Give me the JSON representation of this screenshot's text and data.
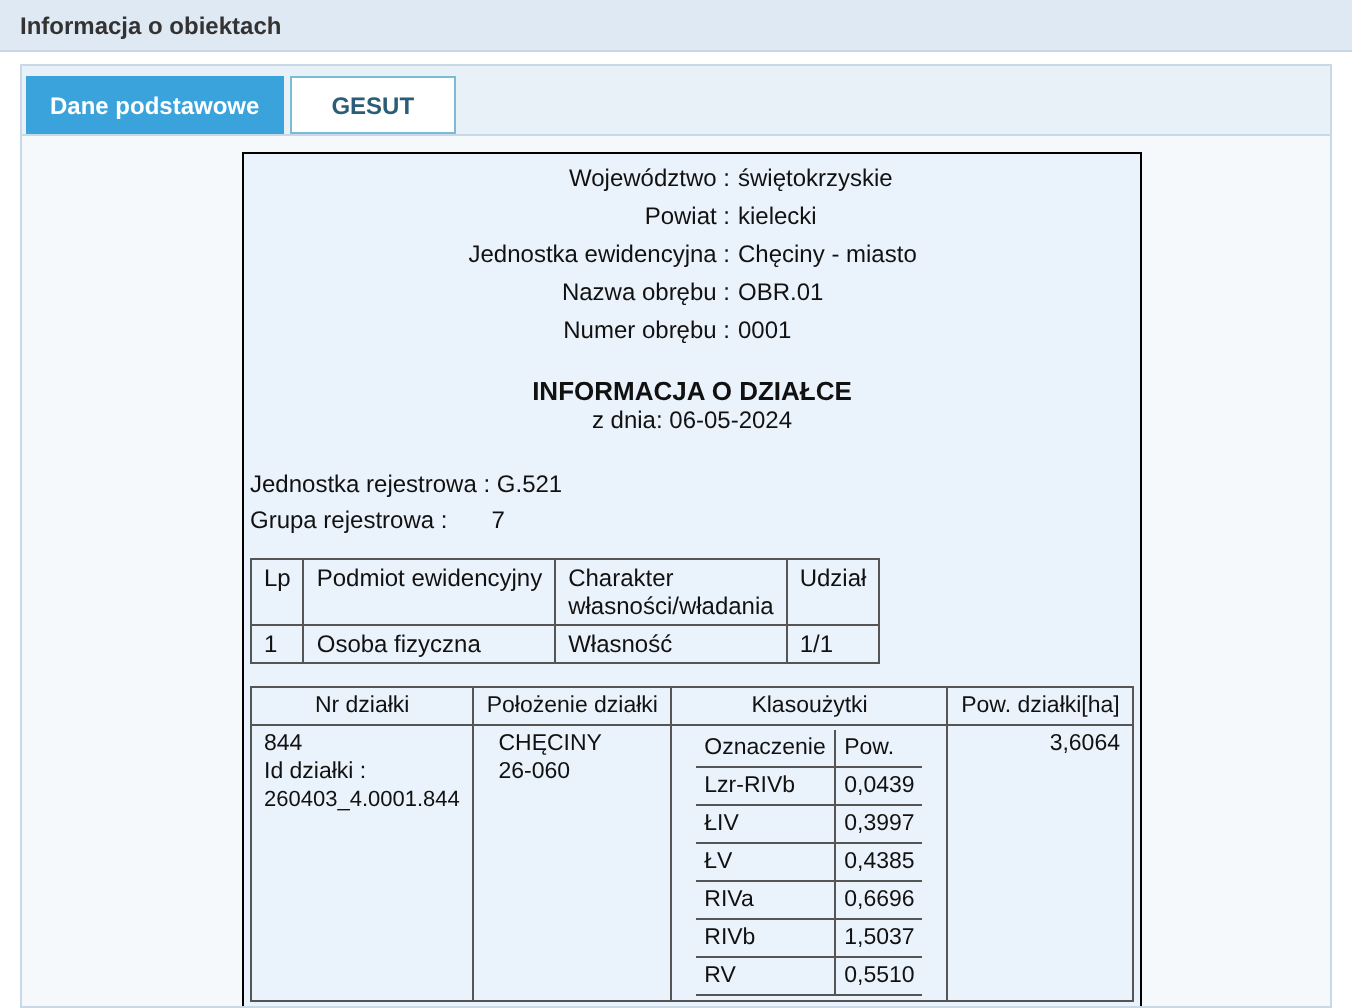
{
  "window": {
    "title": "Informacja o obiektach"
  },
  "tabs": [
    {
      "label": "Dane podstawowe",
      "selected": true
    },
    {
      "label": "GESUT",
      "selected": false
    }
  ],
  "location": [
    {
      "label": "Województwo :",
      "value": "świętokrzyskie"
    },
    {
      "label": "Powiat :",
      "value": "kielecki"
    },
    {
      "label": "Jednostka ewidencyjna :",
      "value": "Chęciny - miasto"
    },
    {
      "label": "Nazwa obrębu :",
      "value": "OBR.01"
    },
    {
      "label": "Numer obrębu :",
      "value": "0001"
    }
  ],
  "heading": "INFORMACJA O DZIAŁCE",
  "date": "z dnia: 06-05-2024",
  "register_unit": {
    "label": "Jednostka rejestrowa :",
    "value": "G.521"
  },
  "register_group": {
    "label": "Grupa rejestrowa :",
    "value": "7"
  },
  "owners": {
    "columns": [
      "Lp",
      "Podmiot ewidencyjny",
      "Charakter własności/władania",
      "Udział"
    ],
    "rows": [
      [
        "1",
        "Osoba fizyczna",
        "Własność",
        "1/1"
      ]
    ]
  },
  "parcel": {
    "columns": [
      "Nr działki",
      "Położenie działki",
      "Klasoużytki",
      "Pow. działki[ha]"
    ],
    "number": "844",
    "id_label": "Id działki :",
    "id": "260403_4.0001.844",
    "place": "CHĘCINY",
    "postcode": "26-060",
    "classes_columns": [
      "Oznaczenie",
      "Pow."
    ],
    "classes": [
      [
        "Lzr-RIVb",
        "0,0439"
      ],
      [
        "ŁIV",
        "0,3997"
      ],
      [
        "ŁV",
        "0,4385"
      ],
      [
        "RIVa",
        "0,6696"
      ],
      [
        "RIVb",
        "1,5037"
      ],
      [
        "RV",
        "0,5510"
      ]
    ],
    "area": "3,6064"
  }
}
